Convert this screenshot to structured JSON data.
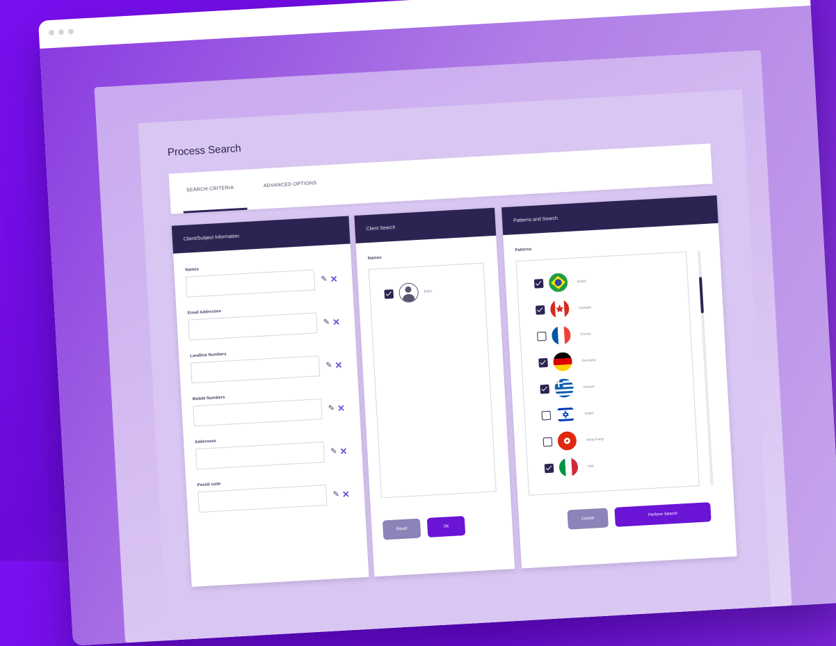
{
  "page": {
    "title": "Process Search",
    "tabs": [
      {
        "label": "SEARCH CRITERIA"
      },
      {
        "label": "ADVANCED OPTIONS"
      }
    ]
  },
  "panel_left": {
    "header": "Client/Subject Information",
    "fields": [
      {
        "label": "Names"
      },
      {
        "label": "Email Addresses"
      },
      {
        "label": "Landline Numbers"
      },
      {
        "label": "Mobile Numbers"
      },
      {
        "label": "Addresses"
      },
      {
        "label": "Postal code"
      }
    ]
  },
  "panel_middle": {
    "header": "Client Search",
    "section_label": "Names",
    "names": [
      {
        "label": "Eden",
        "checked": true
      }
    ],
    "buttons": {
      "secondary": "Reset",
      "primary": "Ok"
    }
  },
  "panel_right": {
    "header": "Patterns and Search",
    "section_label": "Patterns",
    "countries": [
      {
        "name": "Brazil",
        "checked": true
      },
      {
        "name": "Canada",
        "checked": true
      },
      {
        "name": "France",
        "checked": false
      },
      {
        "name": "Germany",
        "checked": true
      },
      {
        "name": "Greece",
        "checked": true
      },
      {
        "name": "Israel",
        "checked": false
      },
      {
        "name": "Hong Kong",
        "checked": false
      },
      {
        "name": "Italy",
        "checked": true
      }
    ],
    "buttons": {
      "secondary": "Cancel",
      "primary": "Perform Search"
    }
  },
  "colors": {
    "accent": "#6a14d6",
    "header": "#2b2453",
    "background": "#7a10f0"
  }
}
